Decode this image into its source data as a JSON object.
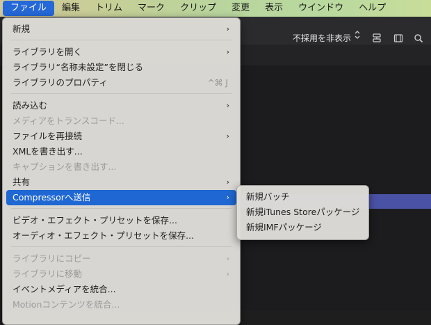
{
  "menubar": {
    "items": [
      "ファイル",
      "編集",
      "トリム",
      "マーク",
      "クリップ",
      "変更",
      "表示",
      "ウインドウ",
      "ヘルプ"
    ]
  },
  "app": {
    "filter_label": "不採用を非表示",
    "filter_chevron": "⌃",
    "icons": [
      "stack-icon",
      "filmstrip-icon",
      "search-icon"
    ]
  },
  "file_menu": {
    "items": [
      {
        "label": "新規",
        "arrow": "›",
        "disabled": false
      },
      {
        "label": "ライブラリを開く",
        "arrow": "›",
        "disabled": false
      },
      {
        "label": "ライブラリ“名称未設定”を閉じる",
        "disabled": false
      },
      {
        "label": "ライブラリのプロパティ",
        "shortcut": "^⌘ J",
        "disabled": false
      },
      {
        "label": "読み込む",
        "arrow": "›",
        "disabled": false
      },
      {
        "label": "メディアをトランスコード...",
        "disabled": true
      },
      {
        "label": "ファイルを再接続",
        "arrow": "›",
        "disabled": false
      },
      {
        "label": "XMLを書き出す...",
        "disabled": false
      },
      {
        "label": "キャプションを書き出す...",
        "disabled": true
      },
      {
        "label": "共有",
        "arrow": "›",
        "disabled": false
      },
      {
        "label": "Compressorへ送信",
        "arrow": "›",
        "disabled": false,
        "highlighted": true
      },
      {
        "label": "ビデオ・エフェクト・プリセットを保存...",
        "disabled": false
      },
      {
        "label": "オーディオ・エフェクト・プリセットを保存...",
        "disabled": false
      },
      {
        "label": "ライブラリにコピー",
        "arrow": "›",
        "disabled": true
      },
      {
        "label": "ライブラリに移動",
        "arrow": "›",
        "disabled": true
      },
      {
        "label": "イベントメディアを統合...",
        "disabled": false
      },
      {
        "label": "Motionコンテンツを統合...",
        "disabled": true
      }
    ]
  },
  "compressor_submenu": {
    "items": [
      "新規バッチ",
      "新規iTunes Storeパッケージ",
      "新規IMFパッケージ"
    ]
  },
  "colors": {
    "highlight": "#1f67d2",
    "menu_bg": "#dedcd8",
    "selection_row": "#4a52a6"
  }
}
